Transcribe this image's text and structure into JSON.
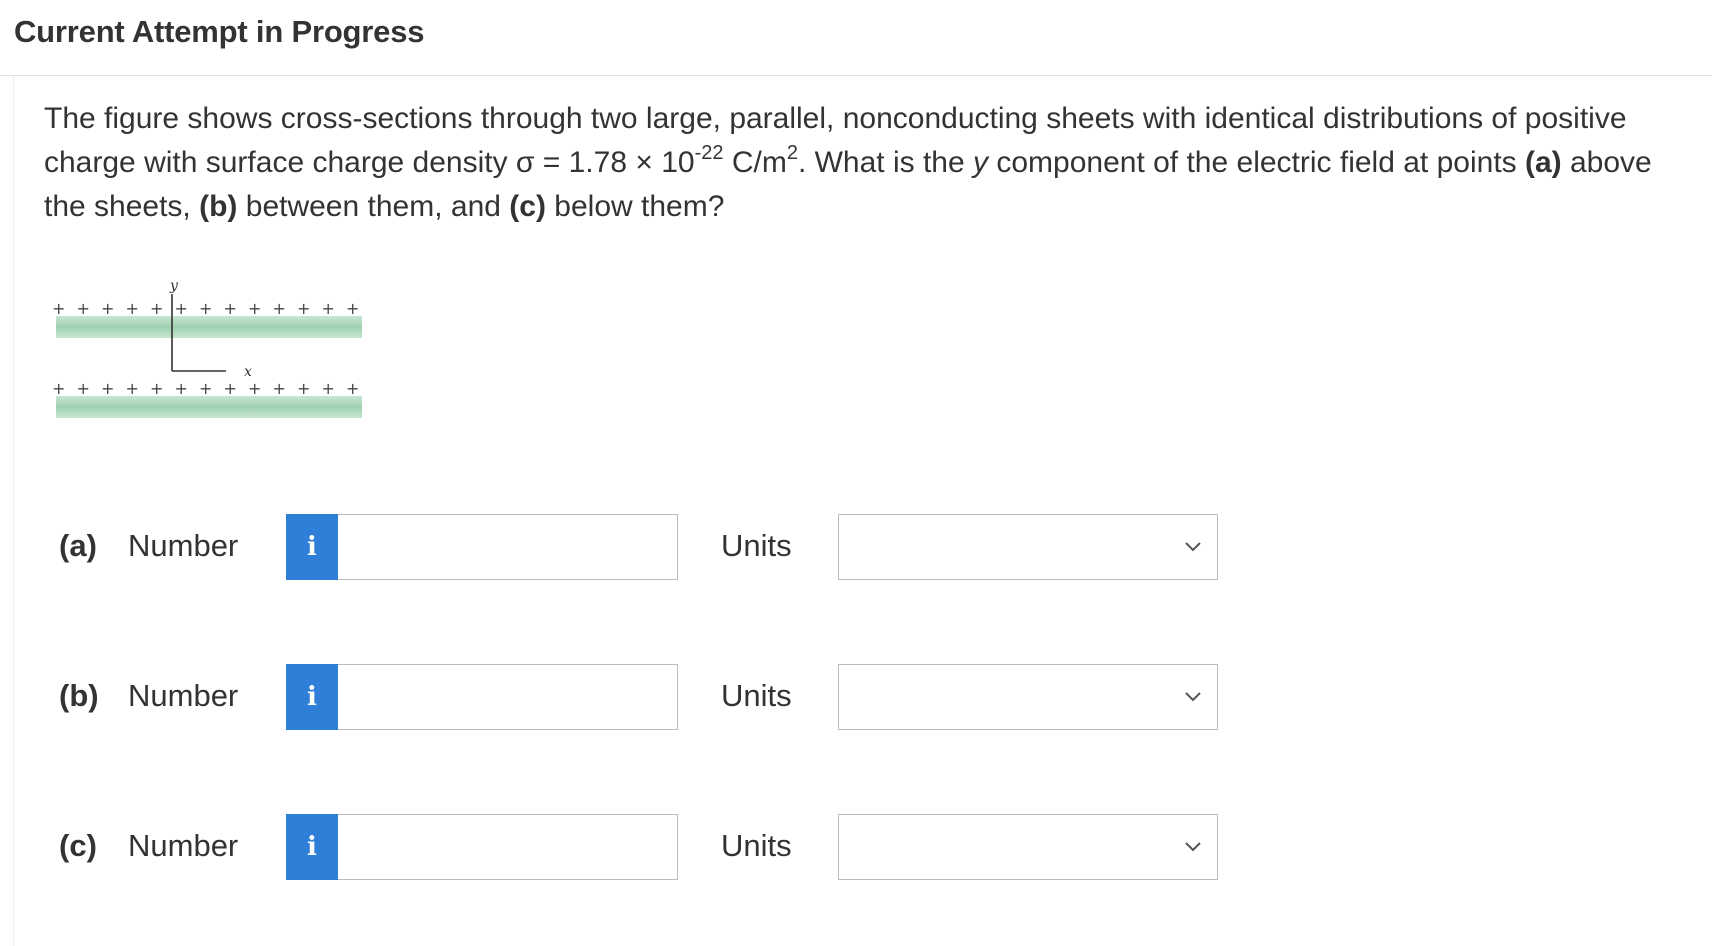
{
  "header": {
    "title": "Current Attempt in Progress"
  },
  "question": {
    "text_1": "The figure shows cross-sections through two large, parallel, nonconducting sheets with identical distributions of positive charge with surface charge density σ = 1.78 × 10",
    "exponent": "-22",
    "text_2": " C/m",
    "unit_power": "2",
    "text_3": ". What is the ",
    "var_y": "y",
    "text_4": " component of the electric field at points ",
    "part_a": "(a)",
    "text_5": " above the sheets, ",
    "part_b": "(b)",
    "text_6": " between them, and ",
    "part_c": "(c)",
    "text_7": " below them?"
  },
  "figure": {
    "y_axis_label": "y",
    "x_axis_label": "x",
    "charge_symbol": "+",
    "sheet_color": "#9fd0b0"
  },
  "answers": {
    "number_label": "Number",
    "units_label": "Units",
    "info_glyph": "i",
    "rows": [
      {
        "part": "(a)",
        "value": "",
        "units": ""
      },
      {
        "part": "(b)",
        "value": "",
        "units": ""
      },
      {
        "part": "(c)",
        "value": "",
        "units": ""
      }
    ]
  },
  "colors": {
    "info_button": "#2f7fd8",
    "text": "#333333",
    "border": "#bdbdbd"
  }
}
